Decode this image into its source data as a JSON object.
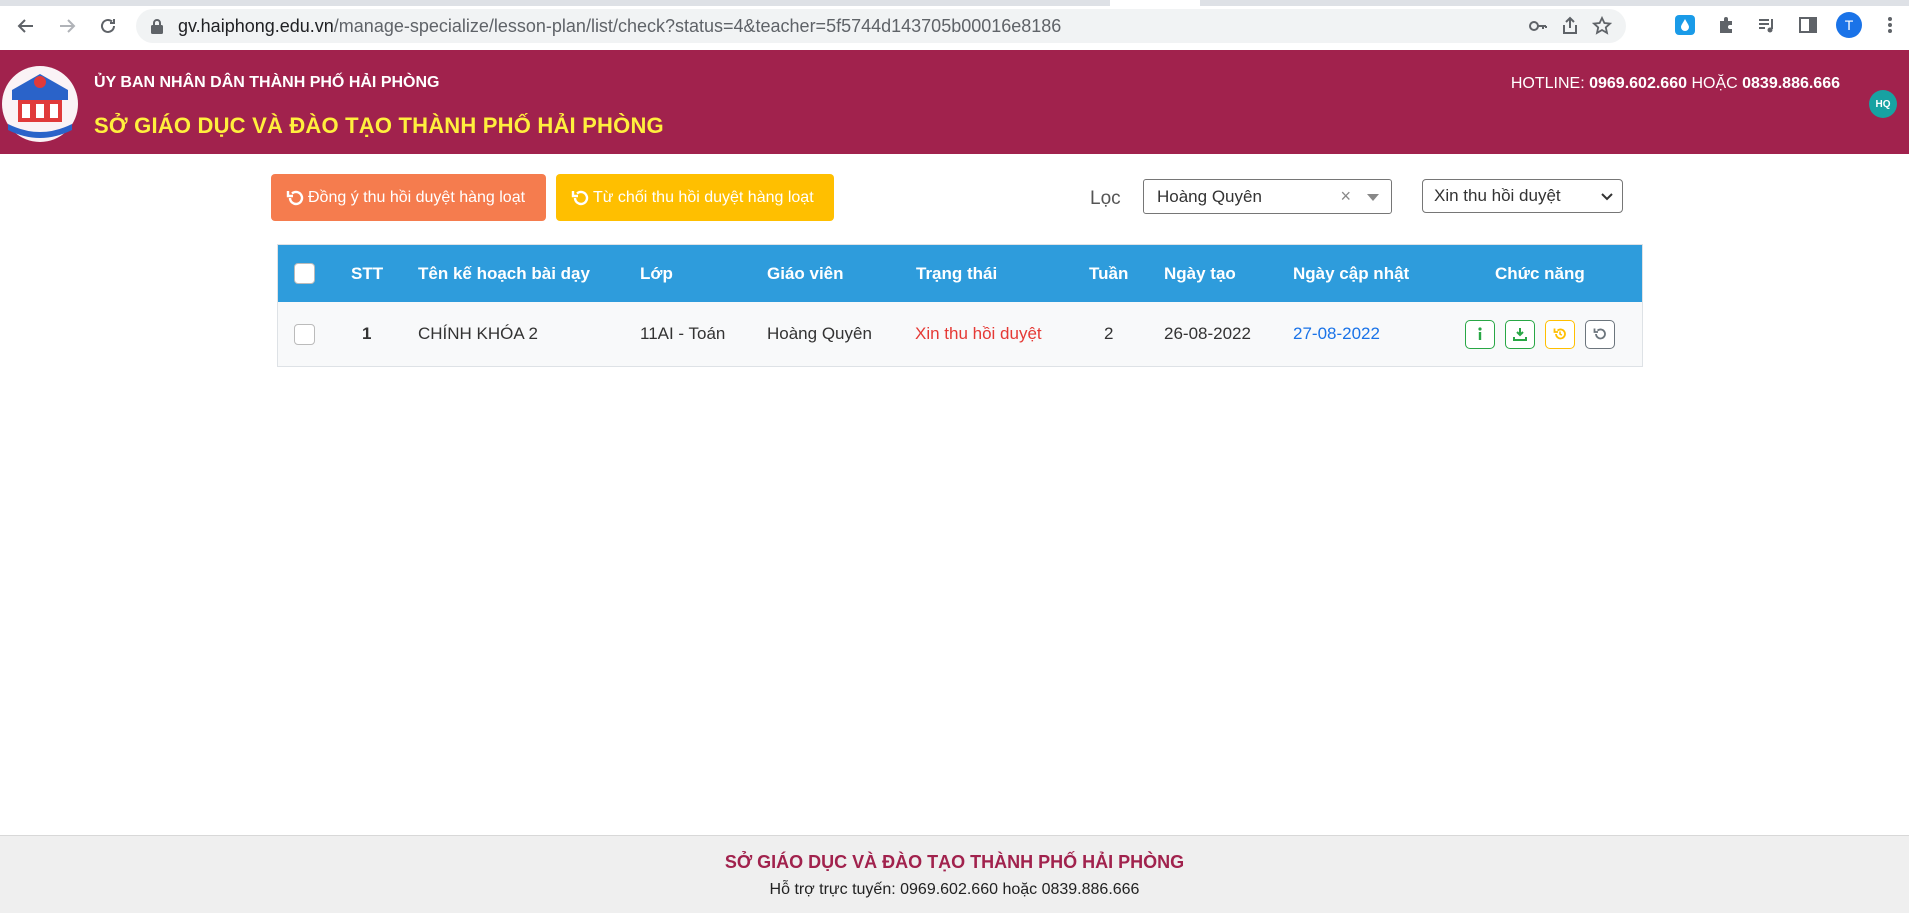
{
  "browser": {
    "url_host": "gv.haiphong.edu.vn",
    "url_path": "/manage-specialize/lesson-plan/list/check?status=4&teacher=5f5744d143705b00016e8186",
    "profile_initial": "T"
  },
  "header": {
    "org_top": "ỦY BAN NHÂN DÂN THÀNH PHỐ HẢI PHÒNG",
    "org_main": "SỞ GIÁO DỤC VÀ ĐÀO TẠO THÀNH PHỐ HẢI PHÒNG",
    "hotline_label": "HOTLINE:",
    "hotline_1": "0969.602.660",
    "hotline_or": "HOẶC",
    "hotline_2": "0839.886.666",
    "user_initials": "HQ",
    "colors": {
      "header_bg": "#a1224d",
      "title_yellow": "#ffef3d"
    }
  },
  "toolbar": {
    "approve_label": "Đồng ý thu hồi duyệt hàng loạt",
    "reject_label": "Từ chối thu hồi duyệt hàng loạt",
    "filter_label": "Lọc",
    "teacher_value": "Hoàng Quyên",
    "status_value": "Xin thu hồi duyệt"
  },
  "table": {
    "headers": {
      "stt": "STT",
      "name": "Tên kế hoạch bài dạy",
      "class": "Lớp",
      "teacher": "Giáo viên",
      "status": "Trạng thái",
      "week": "Tuần",
      "created": "Ngày tạo",
      "updated": "Ngày cập nhật",
      "actions": "Chức năng"
    },
    "rows": [
      {
        "stt": "1",
        "name": "CHÍNH KHÓA 2",
        "class": "11AI - Toán",
        "teacher": "Hoàng Quyên",
        "status": "Xin thu hồi duyệt",
        "week": "2",
        "created": "26-08-2022",
        "updated": "27-08-2022"
      }
    ]
  },
  "footer": {
    "title": "SỞ GIÁO DỤC VÀ ĐÀO TẠO THÀNH PHỐ HẢI PHÒNG",
    "support": "Hỗ trợ trực tuyến: 0969.602.660 hoặc 0839.886.666"
  }
}
